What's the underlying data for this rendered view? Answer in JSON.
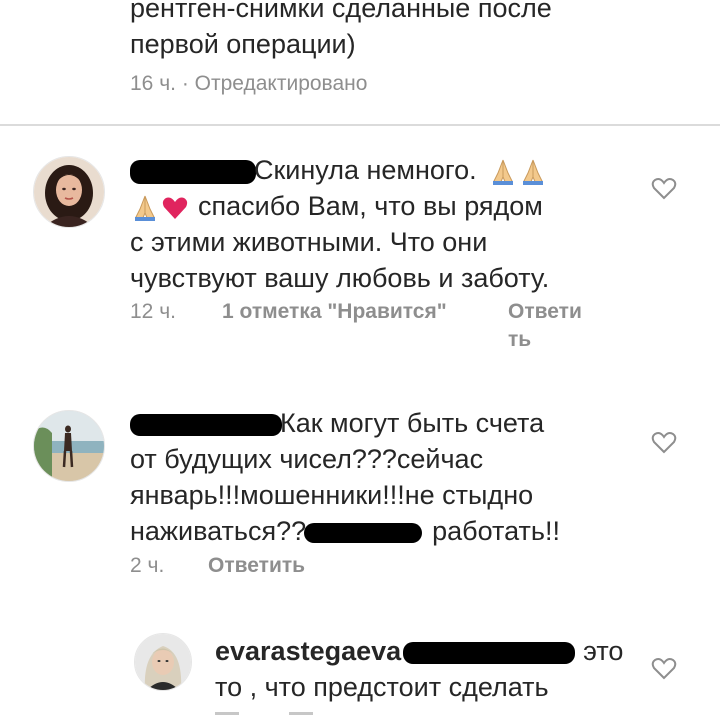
{
  "comment_top": {
    "lines": [
      "рентген-снимки сделанные после",
      "первой операции)"
    ],
    "time": "16 ч.",
    "edited": "· Отредактировано"
  },
  "comment_1": {
    "avatar_icon": "user-avatar-woman-dark-hair",
    "line1_text": "Скинула немного.",
    "line2_text": "спасибо Вам, что вы рядом",
    "line3_text": "с этими животными. Что они",
    "line4_text": "чувствуют вашу любовь и заботу.",
    "time": "12 ч.",
    "likes": "1 отметка \"Нравится\"",
    "reply_line1": "Ответи",
    "reply_line2": "ть",
    "like_icon": "heart-outline-icon"
  },
  "comment_2": {
    "avatar_icon": "user-avatar-beach",
    "line1_text": "Как могут быть счета",
    "line2_text": "от будущих чисел???сейчас",
    "line3_text": "январь!!!мошенники!!!не стыдно",
    "line4_text_a": "наживаться??",
    "line4_text_b": "работать!!",
    "time": "2 ч.",
    "reply": "Ответить",
    "like_icon": "heart-outline-icon"
  },
  "comment_3": {
    "avatar_icon": "user-avatar-blonde",
    "username": "evarastegaeva",
    "line1_text": "это",
    "line2_text": "то , что предстоит сделать",
    "like_icon": "heart-outline-icon"
  },
  "colors": {
    "text": "#262626",
    "meta": "#8e8e8e",
    "divider": "#dbdbdb",
    "heart_emoji": "#e0245e"
  }
}
